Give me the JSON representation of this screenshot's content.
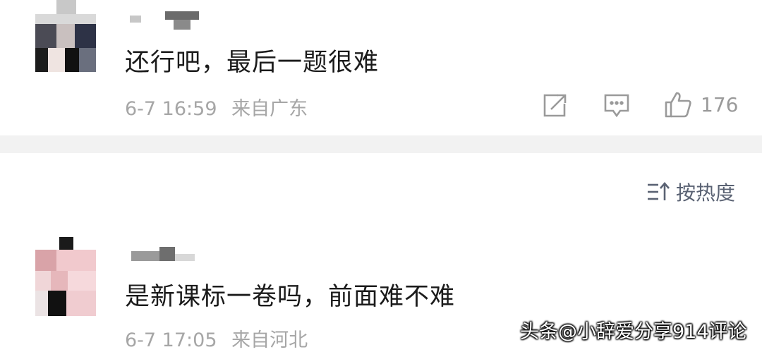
{
  "comments": [
    {
      "text": "还行吧，最后一题很难",
      "date": "6-7 16:59",
      "location": "来自广东",
      "like_count": "176"
    },
    {
      "text": "是新课标一卷吗，前面难不难",
      "date": "6-7 17:05",
      "location": "来自河北"
    }
  ],
  "sort": {
    "label": "按热度"
  },
  "watermark": "头条@小辞爱分享914评论",
  "colors": {
    "divider": "#f2f2f2",
    "meta_text": "#a6a6a6",
    "icon": "#9a9a9a",
    "sort_text": "#5a6273"
  },
  "icons": {
    "share": "share-icon",
    "reply": "comment-icon",
    "like": "thumbs-up-icon",
    "sort": "sort-icon"
  }
}
